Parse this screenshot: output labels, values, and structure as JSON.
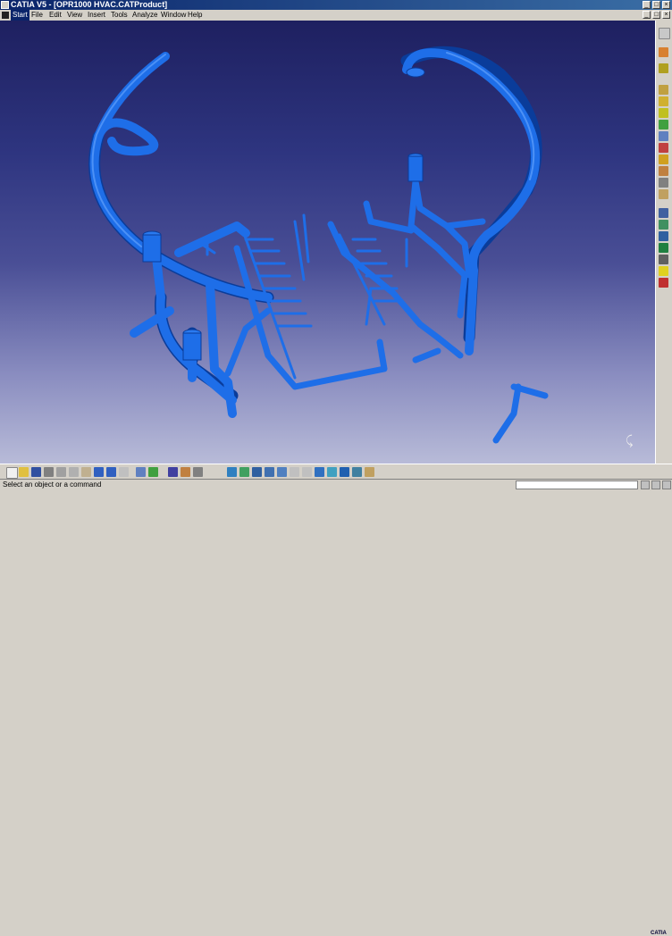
{
  "window": {
    "title": "CATIA V5 - [OPR1000 HVAC.CATProduct]",
    "controls": [
      "_",
      "□",
      "×"
    ]
  },
  "menubar": {
    "items": [
      "Start",
      "File",
      "Edit",
      "View",
      "Insert",
      "Tools",
      "Analyze",
      "Window",
      "Help"
    ],
    "doc_controls": [
      "_",
      "□",
      "×"
    ]
  },
  "viewport": {
    "model": "HVAC piping assembly",
    "logo_text": "CATIA"
  },
  "right_toolbar": {
    "icons": [
      "arrow-select-icon",
      "product-icon",
      "assembly-icon",
      "insert-component-icon",
      "existing-component-icon",
      "replace-component-icon",
      "reorder-icon",
      "renumber-icon",
      "multi-instantiation-icon",
      "fast-multi-instantiation-icon",
      "manipulation-icon",
      "snap-icon",
      "explode-icon",
      "clash-icon",
      "constraint-icon",
      "fix-icon",
      "contact-icon",
      "offset-icon",
      "angle-icon",
      "light-icon",
      "delete-icon"
    ]
  },
  "bottom_toolbar": {
    "icons": [
      "new-icon",
      "open-icon",
      "save-icon",
      "print-icon",
      "cut-icon",
      "copy-icon",
      "paste-icon",
      "undo-icon",
      "redo-icon",
      "whats-this-icon",
      "formula-icon",
      "knowledge-icon",
      "catalog-icon",
      "measure-icon",
      "pan-icon",
      "compass-icon",
      "fly-icon",
      "fit-all-icon",
      "pan-view-icon",
      "rotate-icon",
      "zoom-in-icon",
      "zoom-out-icon",
      "normal-view-icon",
      "iso-view-icon",
      "shading-icon",
      "hide-show-icon",
      "swap-icon",
      "cut-plane-icon",
      "sectioning-icon"
    ]
  },
  "status_bar": {
    "message": "Select an object or a command",
    "command_value": ""
  },
  "colors": {
    "pipe": "#1e6ee8",
    "pipe_dark": "#0a3c9a",
    "titlebar": "#0a246a"
  }
}
